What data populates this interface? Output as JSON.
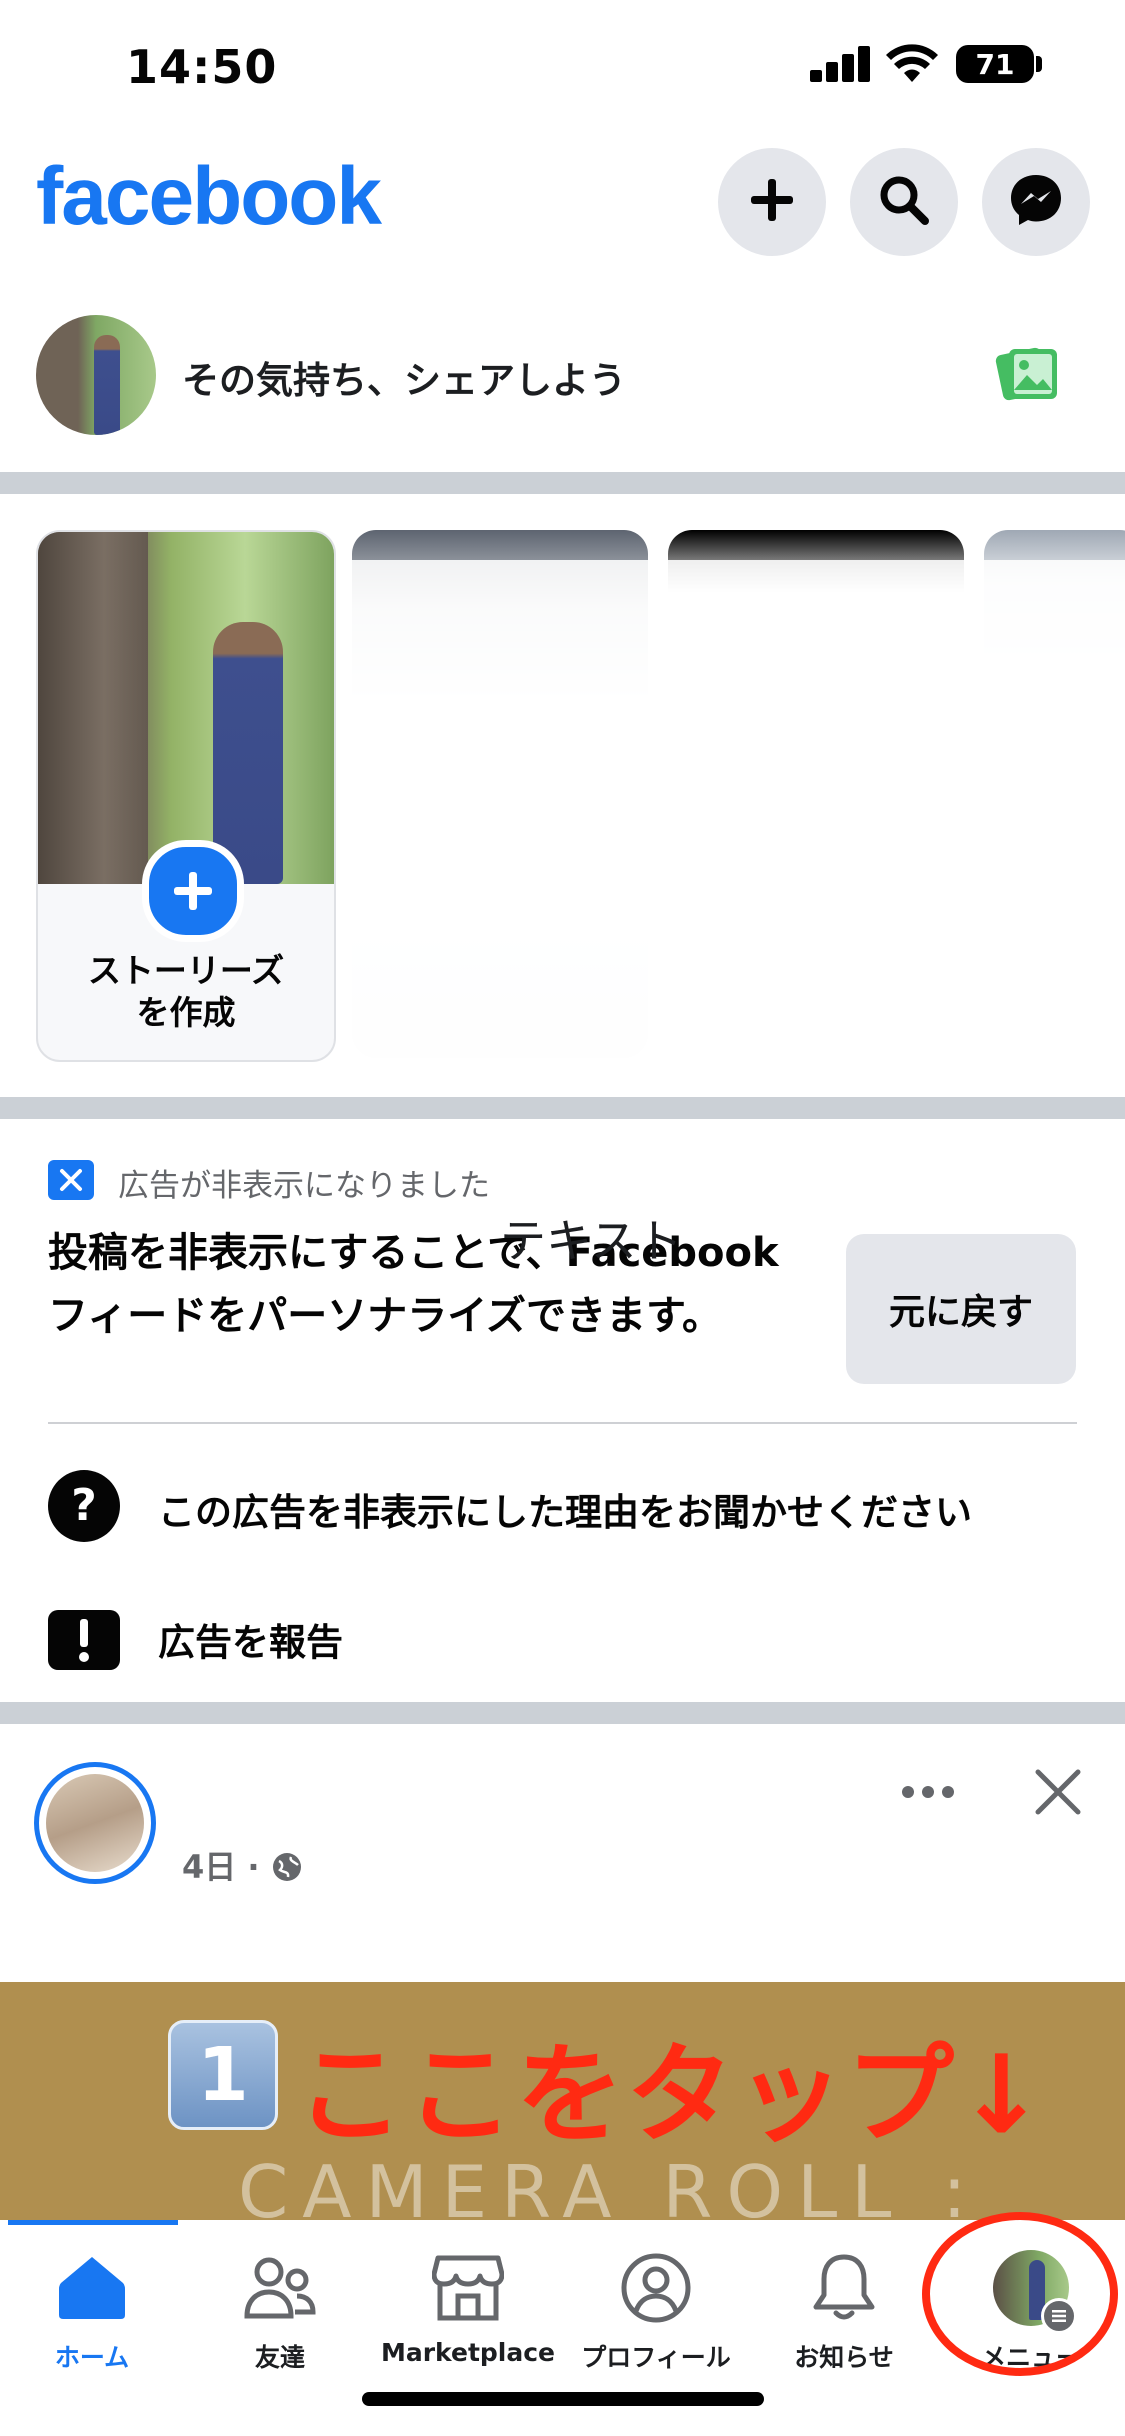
{
  "status_bar": {
    "time": "14:50",
    "battery": "71"
  },
  "header": {
    "logo": "facebook",
    "icons": [
      "plus-icon",
      "search-icon",
      "messenger-icon"
    ]
  },
  "composer": {
    "placeholder": "その気持ち、シェアしよう",
    "icon": "photo-icon"
  },
  "stories": {
    "create_label_line1": "ストーリーズ",
    "create_label_line2": "を作成"
  },
  "hidden_ad": {
    "status": "広告が非表示になりました",
    "description": "投稿を非表示にすることで、Facebook フィードをパーソナライズできます。",
    "overlay_text": "テキスト",
    "undo_label": "元に戻す",
    "options": [
      {
        "icon": "question-icon",
        "label": "この広告を非表示にした理由をお聞かせください"
      },
      {
        "icon": "exclamation-icon",
        "label": "広告を報告"
      }
    ]
  },
  "post": {
    "meta": "4日 ·"
  },
  "tutorial_banner": {
    "number": "1",
    "text": "ここをタップ↓",
    "sub_text": "CAMERA ROLL :"
  },
  "bottom_nav": {
    "items": [
      {
        "label": "ホーム",
        "icon": "home-icon",
        "active": true
      },
      {
        "label": "友達",
        "icon": "friends-icon",
        "active": false
      },
      {
        "label": "Marketplace",
        "icon": "marketplace-icon",
        "active": false
      },
      {
        "label": "プロフィール",
        "icon": "profile-icon",
        "active": false
      },
      {
        "label": "お知らせ",
        "icon": "bell-icon",
        "active": false
      },
      {
        "label": "メニュー",
        "icon": "menu-avatar-icon",
        "active": false
      }
    ]
  },
  "colors": {
    "brand": "#1877f2",
    "annotation_red": "#ff2a12",
    "banner_bg": "#b08f4f"
  }
}
